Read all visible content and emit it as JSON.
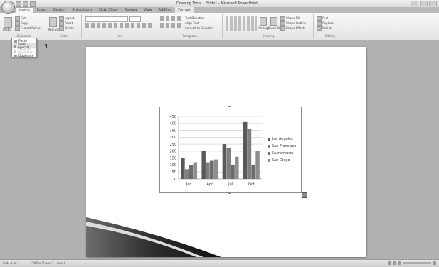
{
  "window": {
    "title_tools": "Drawing Tools",
    "title_doc": "Slide1 - Microsoft PowerPoint"
  },
  "tabs": [
    "Home",
    "Insert",
    "Design",
    "Animations",
    "Slide Show",
    "Review",
    "View",
    "Add-Ins",
    "Format"
  ],
  "ribbon": {
    "clipboard": {
      "label": "Clipboard",
      "paste": "Paste",
      "cut": "Cut",
      "copy": "Copy",
      "format_painter": "Format Painter"
    },
    "slides": {
      "label": "Slides",
      "new_slide": "New Slide",
      "layout": "Layout",
      "reset": "Reset",
      "delete": "Delete"
    },
    "font": {
      "label": "Font"
    },
    "paragraph": {
      "label": "Paragraph",
      "text_direction": "Text Direction",
      "align_text": "Align Text",
      "convert": "Convert to SmartArt"
    },
    "drawing": {
      "label": "Drawing",
      "arrange": "Arrange",
      "quick_styles": "Quick Styles",
      "shape_fill": "Shape Fill",
      "shape_outline": "Shape Outline",
      "shape_effects": "Shape Effects"
    },
    "editing": {
      "label": "Editing",
      "find": "Find",
      "replace": "Replace",
      "select": "Select"
    }
  },
  "paste_menu": [
    {
      "label": "Paste",
      "state": "normal"
    },
    {
      "label": "Paste Special...",
      "state": "highlight"
    },
    {
      "label": "Paste as Hyperlink",
      "state": "disabled"
    },
    {
      "label": "Duplicate",
      "state": "normal"
    }
  ],
  "chart_data": {
    "type": "bar",
    "categories": [
      "Jan",
      "Apr",
      "Jul",
      "Oct"
    ],
    "series": [
      {
        "name": "Los Angeles",
        "color": "#595959",
        "values": [
          150,
          200,
          250,
          410
        ]
      },
      {
        "name": "San Francisco",
        "color": "#7f7f7f",
        "values": [
          70,
          120,
          225,
          360
        ]
      },
      {
        "name": "Sacramento",
        "color": "#6b6b6b",
        "values": [
          100,
          130,
          100,
          100
        ]
      },
      {
        "name": "San Diego",
        "color": "#8e8e8e",
        "values": [
          120,
          140,
          160,
          200
        ]
      }
    ],
    "yticks": [
      0,
      50,
      100,
      150,
      200,
      250,
      300,
      350,
      400,
      450
    ],
    "ylim": [
      0,
      450
    ],
    "grid": true,
    "legend": "right"
  },
  "status": {
    "slide": "Slide 1 of 1",
    "theme": "\"Office Theme\"",
    "lang": "Greek"
  }
}
